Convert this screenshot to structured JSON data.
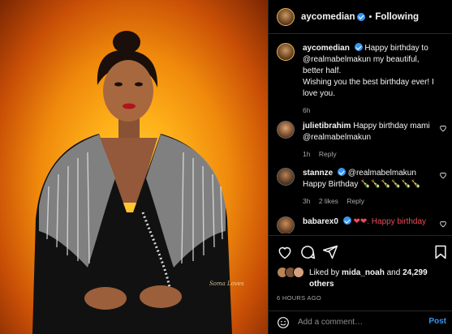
{
  "post": {
    "author": "aycomedian",
    "follow_status": "Following",
    "separator": "•"
  },
  "photo": {
    "signature": "Soma Loves"
  },
  "comments": [
    {
      "user": "aycomedian",
      "text": "Happy birthday to @realmabelmakun my beautiful, better half.",
      "text2": "Wishing you the best birthday ever! I love you.",
      "time": "6h"
    },
    {
      "user": "julietibrahim",
      "text": "Happy birthday mami @realmabelmakun",
      "time": "1h",
      "reply": "Reply"
    },
    {
      "user": "stannze",
      "text": "@realmabelmakun Happy Birthday 🍾🍾🍾🍾🍾🍾",
      "time": "3h",
      "likes": "2 likes",
      "reply": "Reply"
    },
    {
      "user": "babarex0",
      "text": "❤❤. Happy birthday"
    }
  ],
  "likes": {
    "prefix": "Liked by",
    "user": "mida_noah",
    "joiner": "and",
    "count": "24,299",
    "suffix": "others"
  },
  "time_ago": "6 HOURS AGO",
  "add_comment": {
    "placeholder": "Add a comment…",
    "post_label": "Post"
  },
  "colors": {
    "verified": "#3797f0",
    "post_button": "#3797f0",
    "background": "#000000",
    "photo_glow": "#ffb21a"
  },
  "icons": [
    "heart-icon",
    "comment-icon",
    "share-icon",
    "bookmark-icon",
    "emoji-icon",
    "verified-badge-icon"
  ]
}
